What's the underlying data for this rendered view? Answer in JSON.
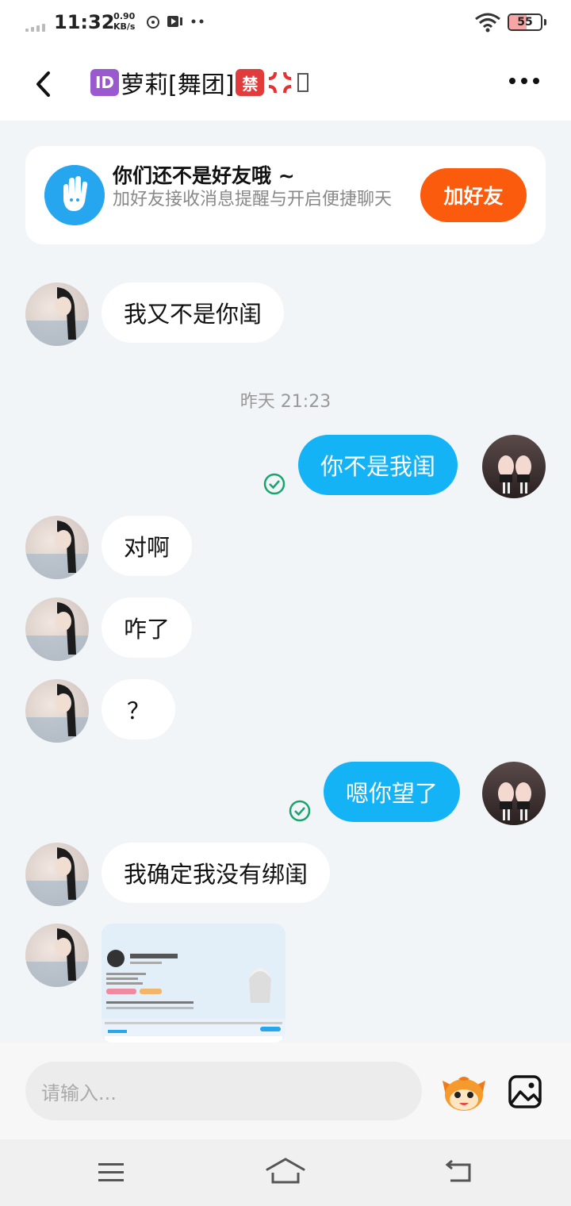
{
  "status_bar": {
    "time": "11:32",
    "speed_value": "0.90",
    "speed_unit": "KB/s",
    "battery": "55",
    "icons": [
      "signal-icon",
      "music-icon",
      "video-icon",
      "more-dots-icon",
      "wifi-icon",
      "battery-icon"
    ]
  },
  "header": {
    "title_prefix_tag": "ID",
    "title_text": "萝莉[舞团]",
    "title_ban_tag": "禁",
    "back_icon": "chevron-left-icon",
    "more_icon": "more-horizontal-icon"
  },
  "friend_card": {
    "title": "你们还不是好友哦 ~",
    "subtitle": "加好友接收消息提醒与开启便捷聊天",
    "button": "加好友"
  },
  "messages": [
    {
      "from": "other",
      "text": "我又不是你闺"
    },
    {
      "from": "time",
      "text": "昨天 21:23"
    },
    {
      "from": "me",
      "text": "你不是我闺",
      "status": "read"
    },
    {
      "from": "other",
      "text": "对啊"
    },
    {
      "from": "other",
      "text": "咋了"
    },
    {
      "from": "other",
      "text": "？"
    },
    {
      "from": "me",
      "text": "嗯你望了",
      "status": "read"
    },
    {
      "from": "other",
      "text": "我确定我没有绑闺"
    },
    {
      "from": "other",
      "type": "image"
    }
  ],
  "input": {
    "placeholder": "请输入..."
  },
  "colors": {
    "accent_blue": "#14b3f6",
    "add_friend_orange": "#fb5b0c",
    "read_tick_green": "#1aa36b"
  }
}
